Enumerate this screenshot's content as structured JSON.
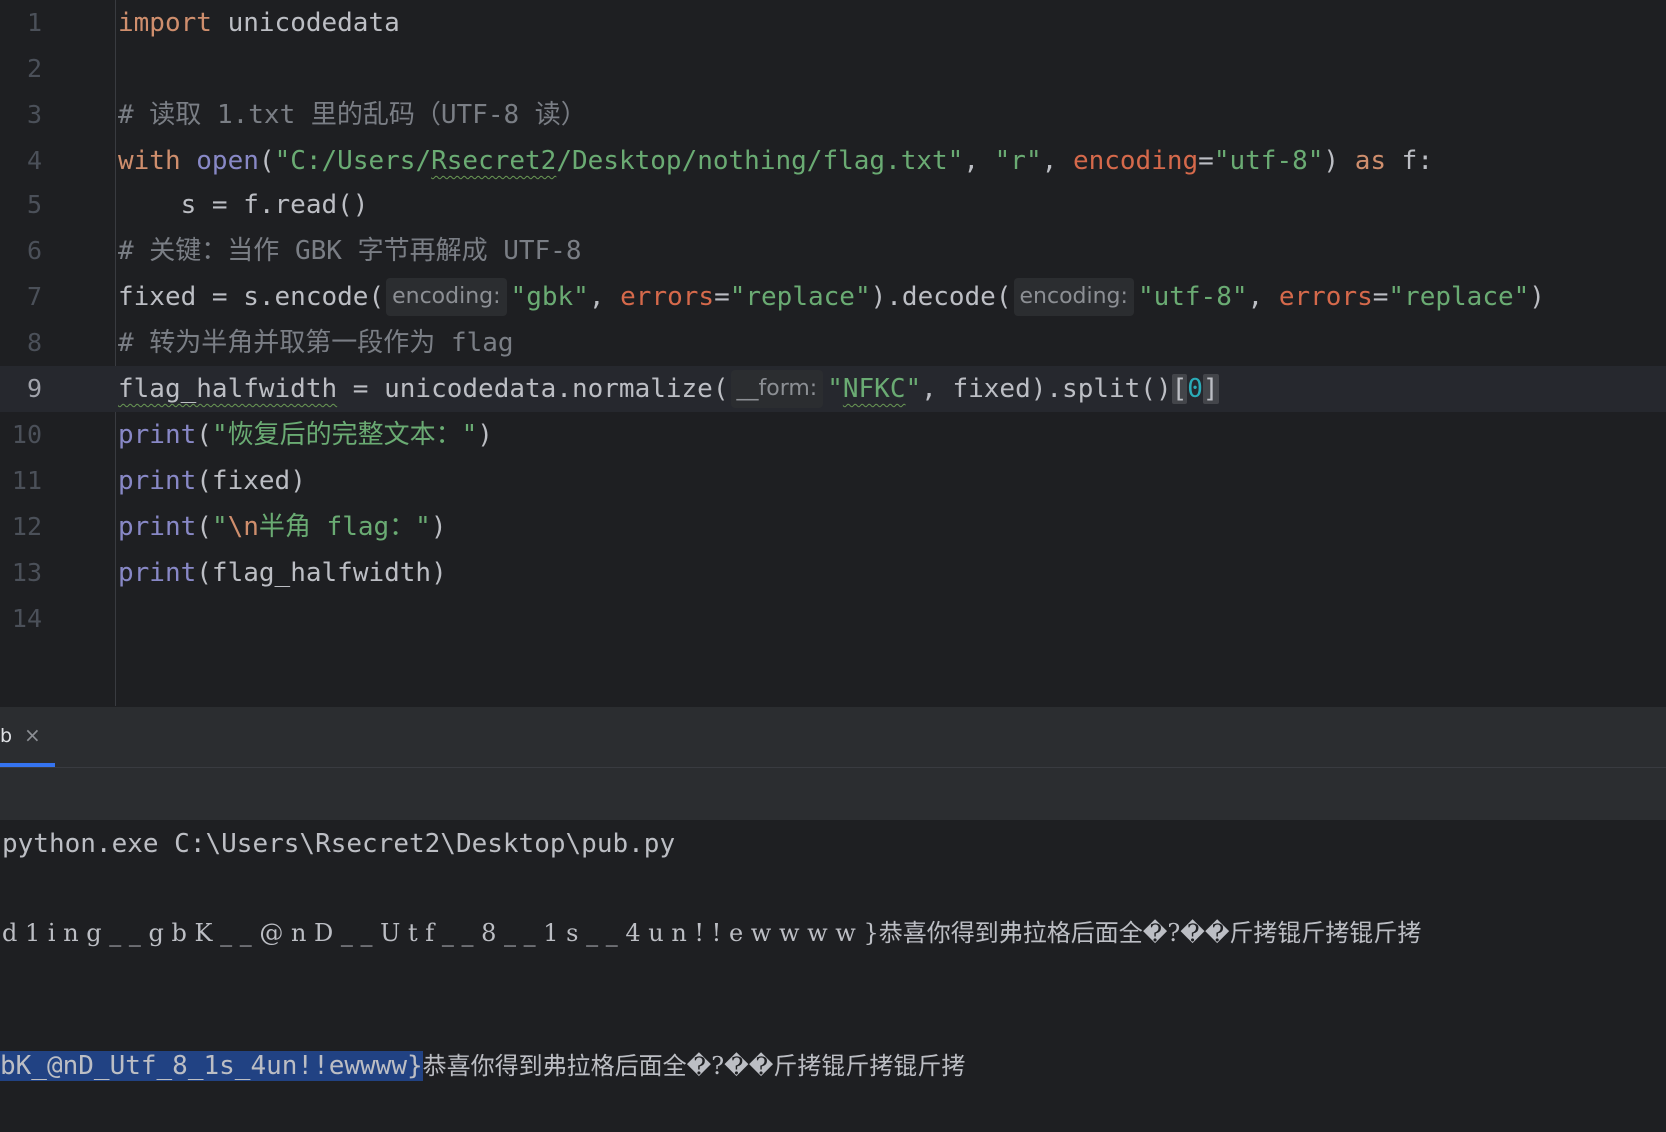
{
  "editor": {
    "current_line": 9,
    "line_numbers": [
      "1",
      "2",
      "3",
      "4",
      "5",
      "6",
      "7",
      "8",
      "9",
      "10",
      "11",
      "12",
      "13",
      "14"
    ],
    "lines": {
      "l1": {
        "kw": "import",
        "rest": " unicodedata"
      },
      "l3": {
        "comment": "# 读取 1.txt 里的乱码（UTF-8 读）"
      },
      "l4": {
        "with": "with",
        "open": "open",
        "p1": "(",
        "path": "\"C:/Users/",
        "path_user": "Rsecret2",
        "path_rest": "/Desktop/nothing/flag.txt\"",
        "comma1": ", ",
        "mode": "\"r\"",
        "comma2": ", ",
        "enc_kw": "encoding",
        "eq": "=",
        "enc_val": "\"utf-8\"",
        "close": ") ",
        "as": "as",
        "tail": " f:"
      },
      "l5": {
        "code": "    s = f.read()"
      },
      "l6": {
        "comment": "# 关键：当作 GBK 字节再解成 UTF-8"
      },
      "l7": {
        "a": "fixed = s.encode(",
        "hint1": "encoding:",
        "gbk": "\"gbk\"",
        "c1": ", ",
        "errors1": "errors",
        "eq1": "=",
        "rep1": "\"replace\"",
        "b": ").decode(",
        "hint2": "encoding:",
        "utf": "\"utf-8\"",
        "c2": ", ",
        "errors2": "errors",
        "eq2": "=",
        "rep2": "\"replace\"",
        "end": ")"
      },
      "l8": {
        "comment": "# 转为半角并取第一段作为 flag"
      },
      "l9": {
        "flag_var": "flag_halfwidth",
        "a": " = unicodedata.normalize(",
        "hint": "__form:",
        "q1": "\"",
        "nfkc": "NFKC",
        "q2": "\"",
        "b": ", fixed).split()",
        "lb": "[",
        "zero": "0",
        "rb": "]"
      },
      "l10": {
        "print": "print",
        "p": "(",
        "str": "\"恢复后的完整文本：\"",
        "end": ")"
      },
      "l11": {
        "print": "print",
        "rest": "(fixed)"
      },
      "l12": {
        "print": "print",
        "p": "(",
        "q1": "\"",
        "esc": "\\n",
        "str": "半角 flag：\"",
        "end": ")"
      },
      "l13": {
        "print": "print",
        "rest": "(flag_halfwidth)"
      }
    }
  },
  "run_panel": {
    "tab_label": "b",
    "tab_close": "×",
    "console": {
      "command": "python.exe C:\\Users\\Rsecret2\\Desktop\\pub.py",
      "full_text": "d 1 i n g _ _ g b K _ _ @ n D _ _ U t f _ _ 8 _ _ 1 s _ _ 4 u n ! ! e w w w w }恭喜你得到弗拉格后面全�?��斤拷锟斤拷锟斤拷",
      "flag_selected": "bK_@nD_Utf_8_1s_4un!!ewwww}",
      "flag_tail": "恭喜你得到弗拉格后面全�?��斤拷锟斤拷锟斤拷"
    }
  },
  "colors": {
    "background": "#1e1f22",
    "keyword": "#cf8e6d",
    "builtin": "#8888c6",
    "string": "#6aab73",
    "comment": "#7a7e85",
    "param": "#d5694b",
    "number": "#2aacb8",
    "selection": "#214283"
  }
}
